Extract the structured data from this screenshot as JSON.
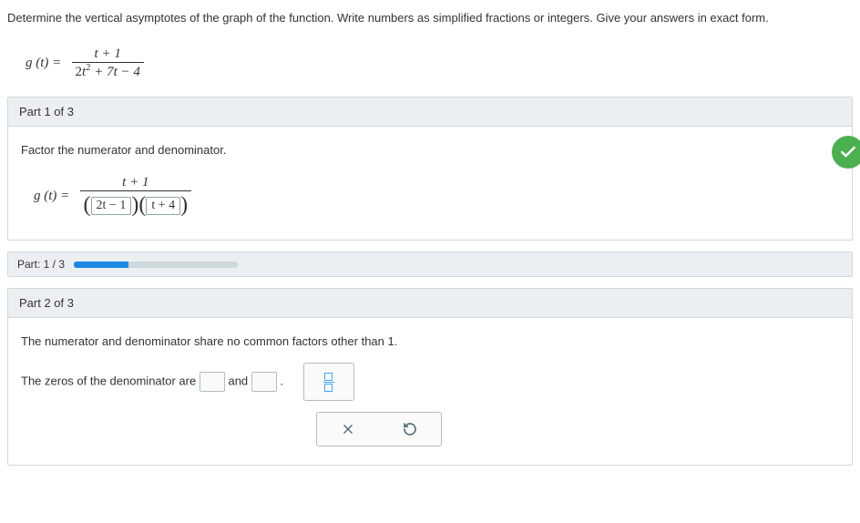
{
  "question": "Determine the vertical asymptotes of the graph of the function. Write numbers as simplified fractions or integers. Give your answers in exact form.",
  "formula": {
    "lhs": "g (t)  =",
    "num": "t + 1",
    "den_a": "2",
    "den_b": "t",
    "den_c": " + 7t − 4",
    "exp": "2"
  },
  "part1": {
    "title": "Part 1 of 3",
    "instruction": "Factor the numerator and denominator.",
    "lhs": "g (t)  =",
    "num": "t + 1",
    "factor1": "2t − 1",
    "factor2": "t + 4"
  },
  "progress": {
    "label": "Part: 1 / 3"
  },
  "part2": {
    "title": "Part 2 of 3",
    "line1": "The numerator and denominator share no common factors other than 1.",
    "line2_a": "The zeros of the denominator are ",
    "line2_b": " and ",
    "line2_c": " ."
  }
}
